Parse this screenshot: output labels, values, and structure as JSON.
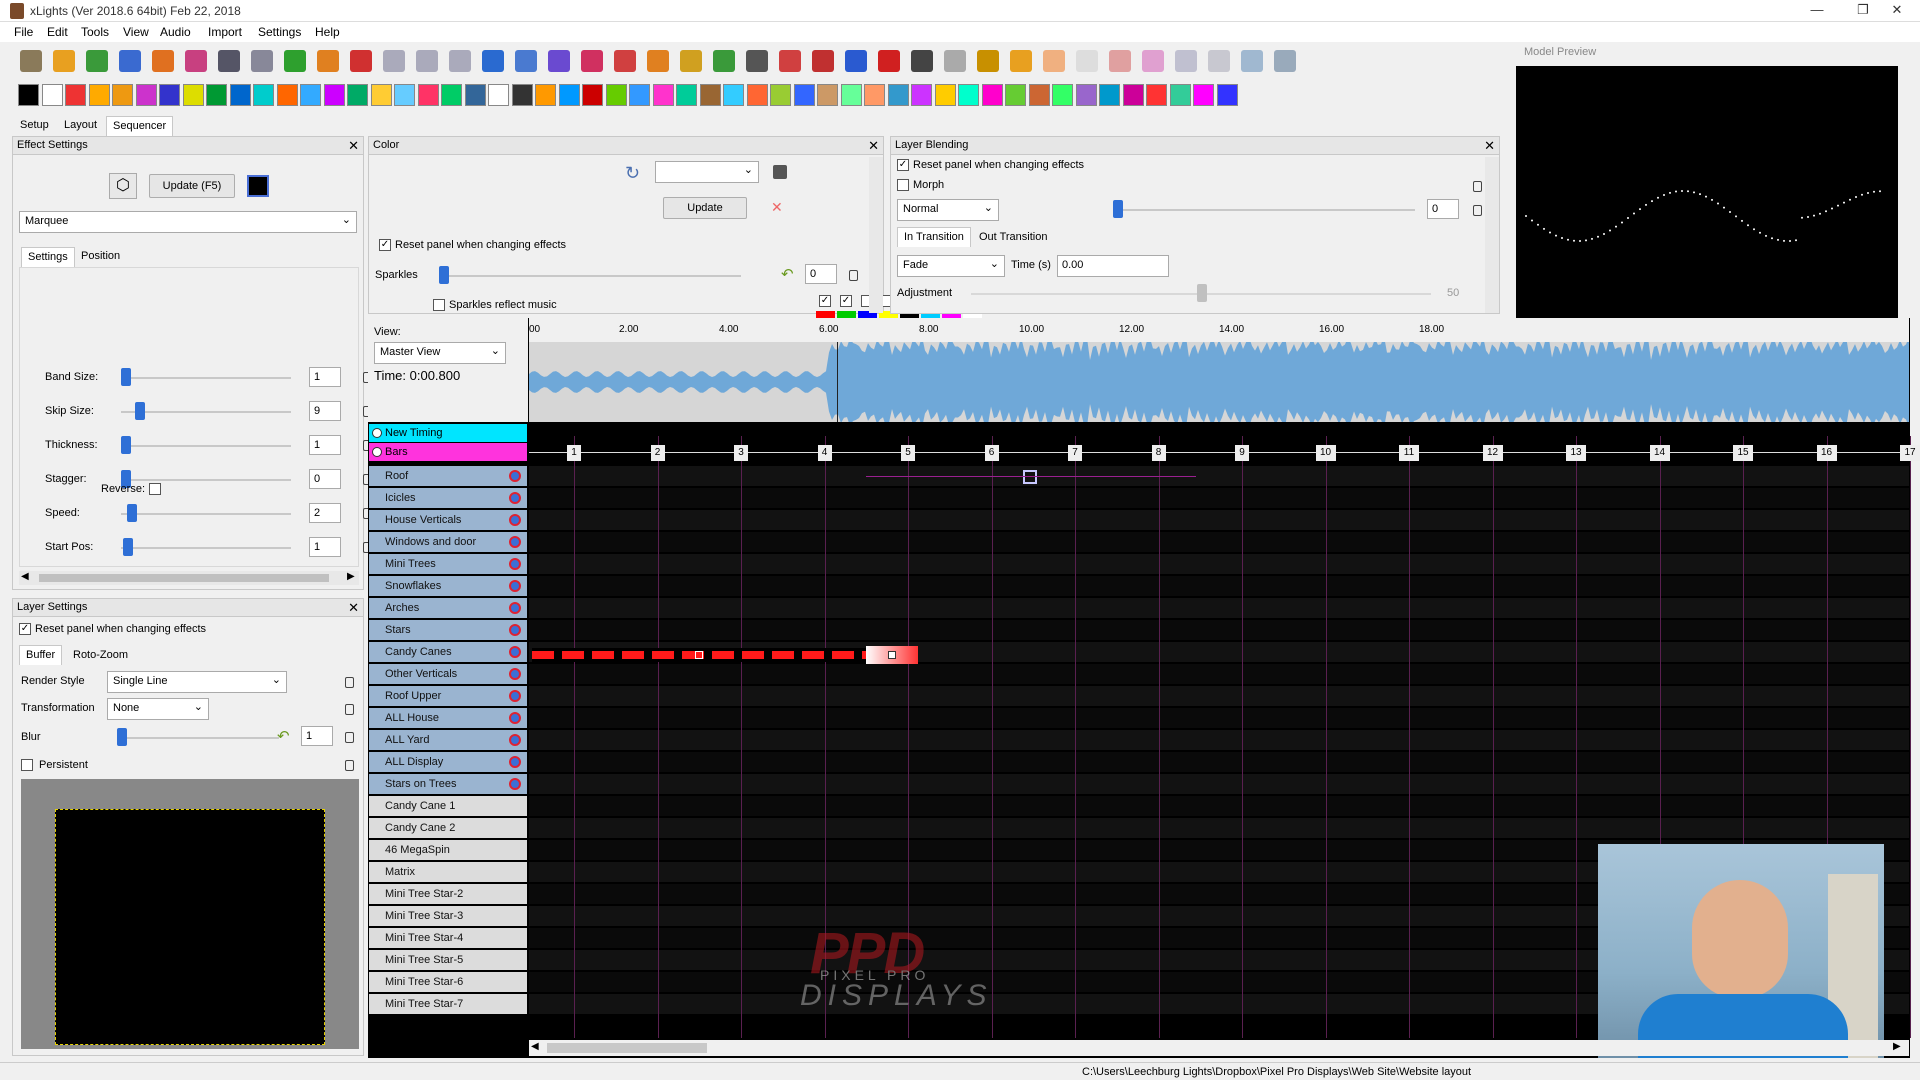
{
  "window": {
    "title": "xLights  (Ver 2018.6 64bit) Feb 22, 2018",
    "min": "—",
    "restore": "❐",
    "close": "✕"
  },
  "menu": [
    "File",
    "Edit",
    "Tools",
    "View",
    "Audio",
    "Import",
    "Settings",
    "Help"
  ],
  "tabs": [
    "Setup",
    "Layout",
    "Sequencer"
  ],
  "effect_settings": {
    "title": "Effect Settings",
    "update_label": "Update (F5)",
    "effect": "Marquee",
    "subtabs": [
      "Settings",
      "Position"
    ],
    "params": [
      {
        "label": "Band Size:",
        "value": "1"
      },
      {
        "label": "Skip Size:",
        "value": "9"
      },
      {
        "label": "Thickness:",
        "value": "1"
      },
      {
        "label": "Stagger:",
        "value": "0"
      },
      {
        "label": "Speed:",
        "value": "2"
      },
      {
        "label": "Start Pos:",
        "value": "1"
      }
    ],
    "reverse_label": "Reverse:"
  },
  "layer_settings": {
    "title": "Layer Settings",
    "reset_label": "Reset panel when changing effects",
    "subtabs": [
      "Buffer",
      "Roto-Zoom"
    ],
    "render_style_label": "Render Style",
    "render_style": "Single Line",
    "transformation_label": "Transformation",
    "transformation": "None",
    "blur_label": "Blur",
    "blur_value": "1",
    "persistent_label": "Persistent"
  },
  "color": {
    "title": "Color",
    "update_label": "Update",
    "reset_label": "Reset panel when changing effects",
    "sparkles_label": "Sparkles",
    "sparkles_value": "0",
    "sparkles_music_label": "Sparkles reflect music",
    "palette": [
      "#ff0000",
      "#00cc00",
      "#0000ff",
      "#ffff00",
      "#000000",
      "#00ccff",
      "#ff00ff",
      "#ffffff"
    ]
  },
  "layer_blending": {
    "title": "Layer Blending",
    "reset_label": "Reset panel when changing effects",
    "morph_label": "Morph",
    "mode": "Normal",
    "mode_value": "0",
    "tabs": [
      "In Transition",
      "Out Transition"
    ],
    "transition": "Fade",
    "time_label": "Time (s)",
    "time_value": "0.00",
    "adjustment_label": "Adjustment",
    "adjustment_value": "50"
  },
  "model_preview": {
    "title": "Model Preview"
  },
  "view": {
    "label": "View:",
    "value": "Master View",
    "time": "Time: 0:00.800"
  },
  "timeline_ticks": [
    "00",
    "2.00",
    "4.00",
    "6.00",
    "8.00",
    "10.00",
    "12.00",
    "14.00",
    "16.00",
    "18.00"
  ],
  "timings": [
    {
      "name": "New Timing",
      "color": "#00e5ff"
    },
    {
      "name": "Bars",
      "color": "#ff33dd"
    }
  ],
  "bar_numbers": [
    "1",
    "2",
    "3",
    "4",
    "5",
    "6",
    "7",
    "8",
    "9",
    "10",
    "11",
    "12",
    "13",
    "14",
    "15",
    "16",
    "17"
  ],
  "models": [
    "Roof",
    "Icicles",
    "House Verticals",
    "Windows and door",
    "Mini Trees",
    "Snowflakes",
    "Arches",
    "Stars",
    "Candy Canes",
    "Other Verticals",
    "Roof Upper",
    "ALL House",
    "ALL Yard",
    "ALL Display",
    "Stars on Trees",
    "Candy Cane 1",
    "Candy Cane 2",
    "46 MegaSpin",
    "Matrix",
    "Mini Tree Star-2",
    "Mini Tree Star-3",
    "Mini Tree Star-4",
    "Mini Tree Star-5",
    "Mini Tree Star-6",
    "Mini Tree Star-7"
  ],
  "watermark": {
    "line1": "PPD",
    "line2": "PIXEL PRO",
    "line3": "DISPLAYS"
  },
  "status_path": "C:\\Users\\Leechburg Lights\\Dropbox\\Pixel Pro Displays\\Web Site\\Website layout"
}
